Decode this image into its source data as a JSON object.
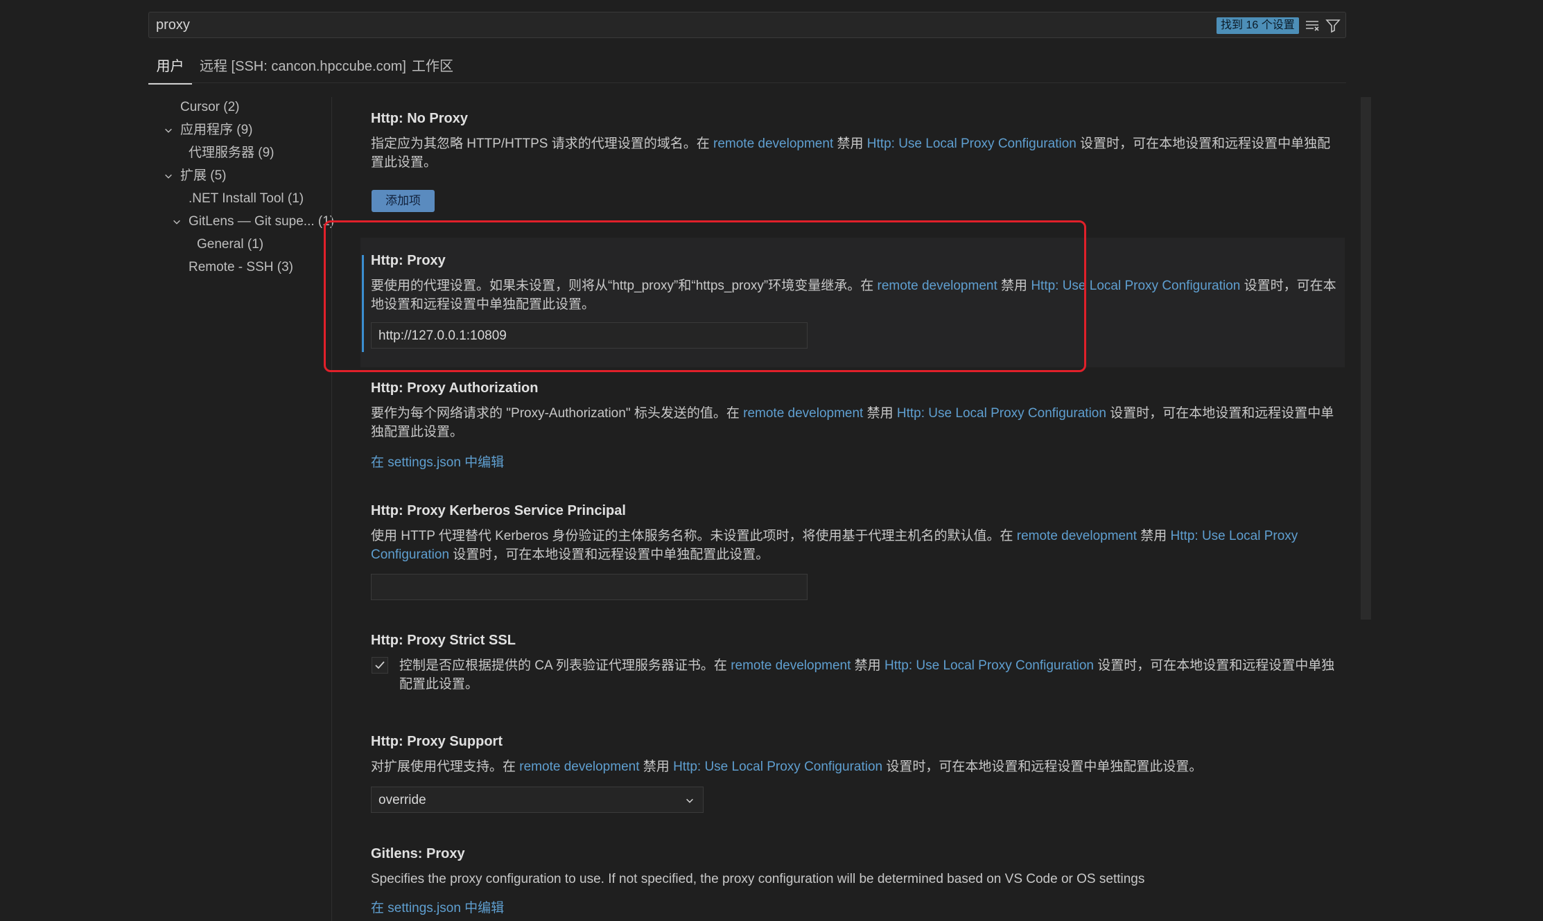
{
  "search": {
    "value": "proxy",
    "result_badge": "找到 16 个设置"
  },
  "tabs": [
    {
      "label": "用户",
      "active": true
    },
    {
      "label": "远程 [SSH: cancon.hpccube.com]",
      "active": false
    },
    {
      "label": "工作区",
      "active": false
    }
  ],
  "toc": [
    {
      "label": "Cursor (2)",
      "expanded": null
    },
    {
      "label": "应用程序 (9)",
      "expanded": true
    },
    {
      "label": "代理服务器 (9)",
      "expanded": null
    },
    {
      "label": "扩展 (5)",
      "expanded": true
    },
    {
      "label": ".NET Install Tool (1)",
      "expanded": null
    },
    {
      "label": "GitLens — Git supe... (1)",
      "expanded": true
    },
    {
      "label": "General (1)",
      "expanded": null
    },
    {
      "label": "Remote - SSH (3)",
      "expanded": null
    }
  ],
  "settings": {
    "no_proxy": {
      "title": "Http: No Proxy",
      "desc_a": "指定应为其忽略 HTTP/HTTPS 请求的代理设置的域名。在 ",
      "link1": "remote development",
      "desc_b": " 禁用 ",
      "link2": "Http: Use Local Proxy Configuration",
      "desc_c": " 设置时，可在本地设置和远程设置中单独配置此设置。",
      "button": "添加项"
    },
    "proxy": {
      "title": "Http: Proxy",
      "desc_a": "要使用的代理设置。如果未设置，则将从“http_proxy”和“https_proxy”环境变量继承。在 ",
      "link1": "remote development",
      "desc_b": " 禁用 ",
      "link2": "Http: Use Local Proxy Configuration",
      "desc_c": " 设置时，可在本地设置和远程设置中单独配置此设置。",
      "value": "http://127.0.0.1:10809"
    },
    "proxy_auth": {
      "title": "Http: Proxy Authorization",
      "desc_a": "要作为每个网络请求的 \"Proxy-Authorization\" 标头发送的值。在 ",
      "link1": "remote development",
      "desc_b": " 禁用 ",
      "link2": "Http: Use Local Proxy Configuration",
      "desc_c": " 设置时，可在本地设置和远程设置中单独配置此设置。",
      "edit": "在 settings.json 中编辑"
    },
    "kerberos": {
      "title": "Http: Proxy Kerberos Service Principal",
      "desc_a": "使用 HTTP 代理替代 Kerberos 身份验证的主体服务名称。未设置此项时，将使用基于代理主机名的默认值。在 ",
      "link1": "remote development",
      "desc_b": " 禁用 ",
      "link2": "Http: Use Local Proxy Configuration",
      "desc_c": " 设置时，可在本地设置和远程设置中单独配置此设置。",
      "value": ""
    },
    "strict_ssl": {
      "title": "Http: Proxy Strict SSL",
      "desc_a": "控制是否应根据提供的 CA 列表验证代理服务器证书。在 ",
      "link1": "remote development",
      "desc_b": " 禁用 ",
      "link2": "Http: Use Local Proxy Configuration",
      "desc_c": " 设置时，可在本地设置和远程设置中单独配置此设置。",
      "checked": true
    },
    "support": {
      "title": "Http: Proxy Support",
      "desc_a": "对扩展使用代理支持。在 ",
      "link1": "remote development",
      "desc_b": " 禁用 ",
      "link2": "Http: Use Local Proxy Configuration",
      "desc_c": " 设置时，可在本地设置和远程设置中单独配置此设置。",
      "selected": "override"
    },
    "gitlens": {
      "title": "Gitlens: Proxy",
      "desc": "Specifies the proxy configuration to use. If not specified, the proxy configuration will be determined based on VS Code or OS settings",
      "edit": "在 settings.json 中编辑"
    }
  },
  "colors": {
    "accent": "#3b8fd1",
    "link": "#5f9fd0",
    "highlight": "#e0202a",
    "background": "#1f1f1f"
  }
}
